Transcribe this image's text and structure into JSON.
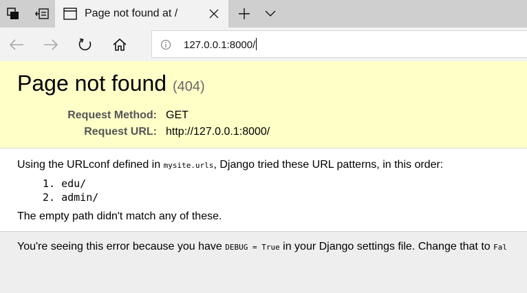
{
  "browser": {
    "tab": {
      "title": "Page not found at /"
    },
    "address_bar": {
      "url": "127.0.0.1:8000/"
    }
  },
  "page": {
    "heading": "Page not found",
    "status_code": "(404)",
    "request_method_label": "Request Method:",
    "request_method_value": "GET",
    "request_url_label": "Request URL:",
    "request_url_value": "http://127.0.0.1:8000/",
    "info_prefix": "Using the URLconf defined in ",
    "urlconf_name": "mysite.urls",
    "info_suffix": ", Django tried these URL patterns, in this order:",
    "patterns": [
      {
        "number": "1.",
        "pattern": "edu/"
      },
      {
        "number": "2.",
        "pattern": "admin/"
      }
    ],
    "no_match_text": "The empty path didn't match any of these.",
    "explanation_prefix": "You're seeing this error because you have ",
    "debug_code": "DEBUG = True",
    "explanation_suffix": " in your Django settings file. Change that to ",
    "explanation_cut": "Fal"
  }
}
